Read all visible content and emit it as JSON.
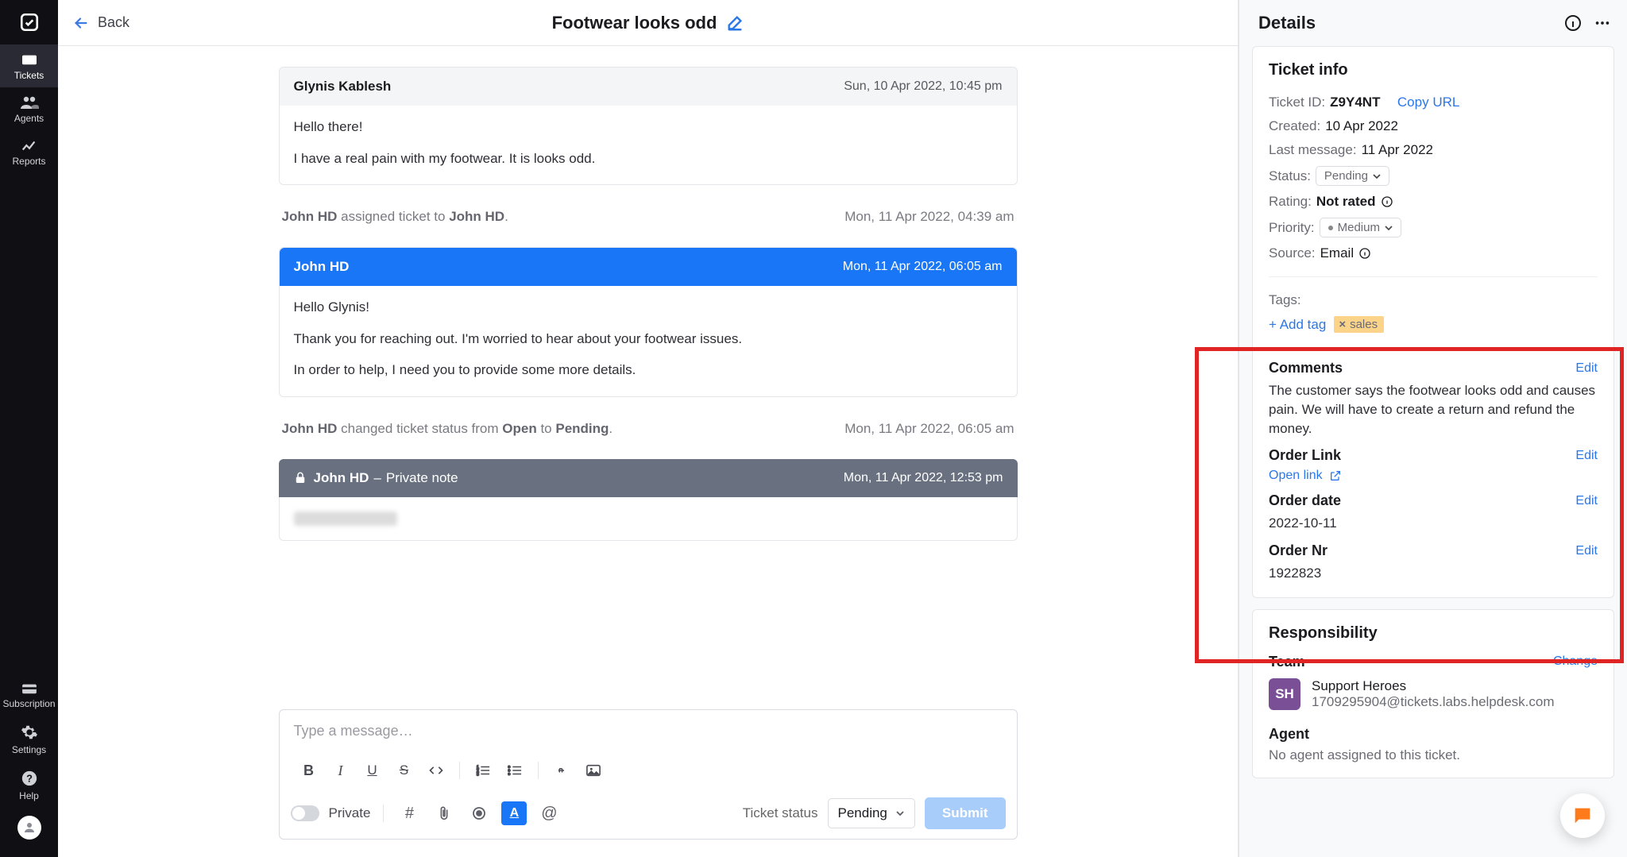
{
  "nav": {
    "items": [
      "Tickets",
      "Agents",
      "Reports"
    ],
    "bottom": [
      "Subscription",
      "Settings",
      "Help"
    ]
  },
  "header": {
    "back": "Back",
    "title": "Footwear looks odd"
  },
  "thread": {
    "m0": {
      "sender": "Glynis Kablesh",
      "ts": "Sun, 10 Apr 2022, 10:45 pm",
      "p0": "Hello there!",
      "p1": "I have a real pain with my footwear. It is looks odd."
    },
    "log0": {
      "who": "John HD",
      "mid": " assigned ticket to ",
      "whom": "John HD",
      "dot": ".",
      "ts": "Mon, 11 Apr 2022, 04:39 am"
    },
    "m1": {
      "sender": "John HD",
      "ts": "Mon, 11 Apr 2022, 06:05 am",
      "p0": "Hello Glynis!",
      "p1": "Thank you for reaching out. I'm worried to hear about your footwear issues.",
      "p2": "In order to help, I need you to provide some more details."
    },
    "log1": {
      "who": "John HD",
      "mid": " changed ticket status from ",
      "from": "Open",
      "to_word": " to ",
      "to": "Pending",
      "dot": ".",
      "ts": "Mon, 11 Apr 2022, 06:05 am"
    },
    "m2": {
      "sender": "John HD",
      "note": "Private note",
      "dash": " – ",
      "ts": "Mon, 11 Apr 2022, 12:53 pm"
    }
  },
  "composer": {
    "placeholder": "Type a message…",
    "private": "Private",
    "status_label": "Ticket status",
    "status_value": "Pending",
    "submit": "Submit"
  },
  "details": {
    "title": "Details",
    "ticket_info": {
      "title": "Ticket info",
      "id_label": "Ticket ID:",
      "id": "Z9Y4NT",
      "copy": "Copy URL",
      "created_label": "Created:",
      "created": "10 Apr 2022",
      "last_label": "Last message:",
      "last": "11 Apr 2022",
      "status_label": "Status:",
      "status": "Pending",
      "rating_label": "Rating:",
      "rating": "Not rated",
      "priority_label": "Priority:",
      "priority": "Medium",
      "source_label": "Source:",
      "source": "Email",
      "tags_label": "Tags:",
      "add_tag": "+ Add tag",
      "tag0": "sales",
      "comments_label": "Comments",
      "comments_body": "The customer says the footwear looks odd and causes pain. We will have to create a return and refund the money.",
      "order_link_label": "Order Link",
      "open_link": "Open link",
      "order_date_label": "Order date",
      "order_date": "2022-10-11",
      "order_nr_label": "Order Nr",
      "order_nr": "1922823",
      "edit": "Edit"
    },
    "responsibility": {
      "title": "Responsibility",
      "team_label": "Team",
      "change": "Change",
      "team_initials": "SH",
      "team_name": "Support Heroes",
      "team_email": "1709295904@tickets.labs.helpdesk.com",
      "agent_label": "Agent",
      "no_agent": "No agent assigned to this ticket."
    }
  }
}
